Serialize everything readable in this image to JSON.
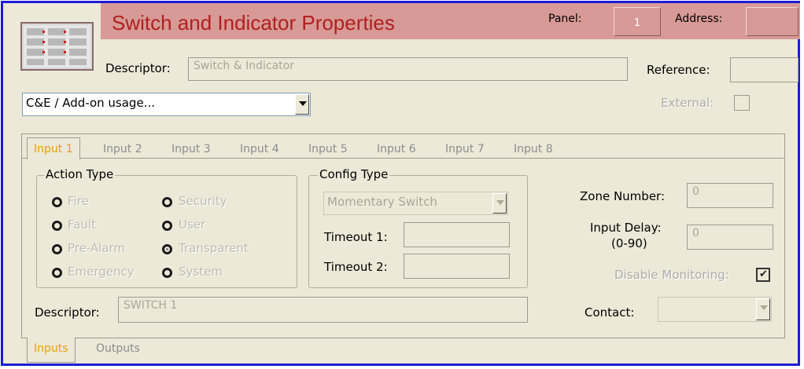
{
  "header": {
    "title": "Switch and Indicator Properties",
    "panel_label": "Panel:",
    "panel_value": "1",
    "address_label": "Address:",
    "address_value": ""
  },
  "top": {
    "descriptor_label": "Descriptor:",
    "descriptor_placeholder": "Switch & Indicator",
    "reference_label": "Reference:",
    "reference_value": "",
    "usage_select": "C&E / Add-on usage...",
    "external_label": "External:"
  },
  "input_tabs": [
    "Input 1",
    "Input 2",
    "Input 3",
    "Input 4",
    "Input 5",
    "Input 6",
    "Input 7",
    "Input 8"
  ],
  "action_type": {
    "legend": "Action Type",
    "options": [
      "Fire",
      "Fault",
      "Pre-Alarm",
      "Emergency",
      "Security",
      "User",
      "Transparent",
      "System"
    ],
    "selected": "Transparent"
  },
  "config_type": {
    "legend": "Config Type",
    "select_value": "Momentary Switch",
    "timeout1_label": "Timeout 1:",
    "timeout1_value": "",
    "timeout2_label": "Timeout 2:",
    "timeout2_value": ""
  },
  "right_panel": {
    "zone_label": "Zone Number:",
    "zone_value": "0",
    "delay_label": "Input Delay:",
    "delay_range": "(0-90)",
    "delay_value": "0",
    "disable_monitoring_label": "Disable Monitoring:",
    "disable_monitoring_checked": true,
    "contact_label": "Contact:",
    "contact_value": ""
  },
  "input_descriptor": {
    "label": "Descriptor:",
    "value": "SWITCH 1"
  },
  "bottom_tabs": [
    "Inputs",
    "Outputs"
  ],
  "colors": {
    "header_bg": "#d89a96",
    "title_text": "#b02020",
    "active_tab_text": "#e8a000",
    "window_border": "#1c1cd8"
  }
}
